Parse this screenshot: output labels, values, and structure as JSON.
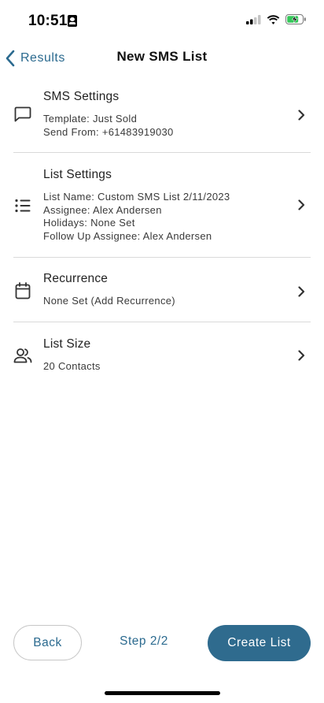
{
  "status_bar": {
    "time": "10:51",
    "icons": [
      "id-card-icon",
      "signal-icon",
      "wifi-icon",
      "battery-charging-icon"
    ]
  },
  "header": {
    "back_label": "Results",
    "title": "New SMS List"
  },
  "rows": {
    "sms_settings": {
      "title": "SMS Settings",
      "icon": "message-icon",
      "lines": [
        "Template: Just Sold",
        "Send From: +61483919030"
      ]
    },
    "list_settings": {
      "title": "List Settings",
      "icon": "list-icon",
      "lines": [
        "List Name: Custom SMS List 2/11/2023",
        "Assignee: Alex Andersen",
        "Holidays: None Set",
        "Follow Up Assignee: Alex Andersen"
      ]
    },
    "recurrence": {
      "title": "Recurrence",
      "icon": "calendar-icon",
      "lines": [
        "None Set (Add Recurrence)"
      ]
    },
    "list_size": {
      "title": "List Size",
      "icon": "people-icon",
      "lines": [
        "20 Contacts"
      ]
    }
  },
  "footer": {
    "back_label": "Back",
    "step_label": "Step 2/2",
    "create_label": "Create List"
  },
  "colors": {
    "accent": "#2b6a8f",
    "primary_button": "#2f6b8e",
    "battery_fill": "#34c759"
  }
}
